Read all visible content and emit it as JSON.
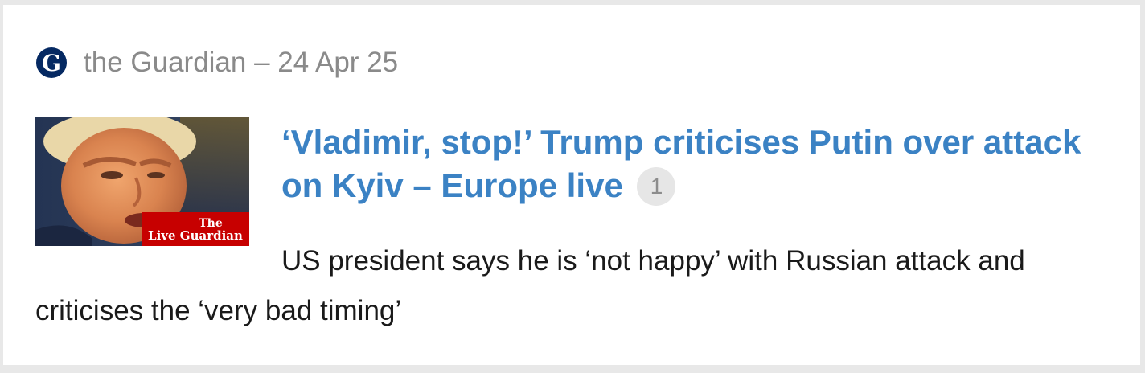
{
  "source": {
    "logo_icon": "guardian-g-logo",
    "text": "the Guardian – 24 Apr 25"
  },
  "thumbnail": {
    "overlay_line1": "The",
    "overlay_line2": "Live Guardian"
  },
  "article": {
    "headline": "‘Vladimir, stop!’ Trump criticises Putin over attack on Kyiv – Europe live",
    "comment_count": "1",
    "summary": "US president says he is ‘not happy’ with Russian attack and criticises the ‘very bad timing’"
  },
  "colors": {
    "headline": "#3b82c4",
    "source_text": "#8a8a8a",
    "guardian_navy": "#052962",
    "live_red": "#c70000"
  }
}
